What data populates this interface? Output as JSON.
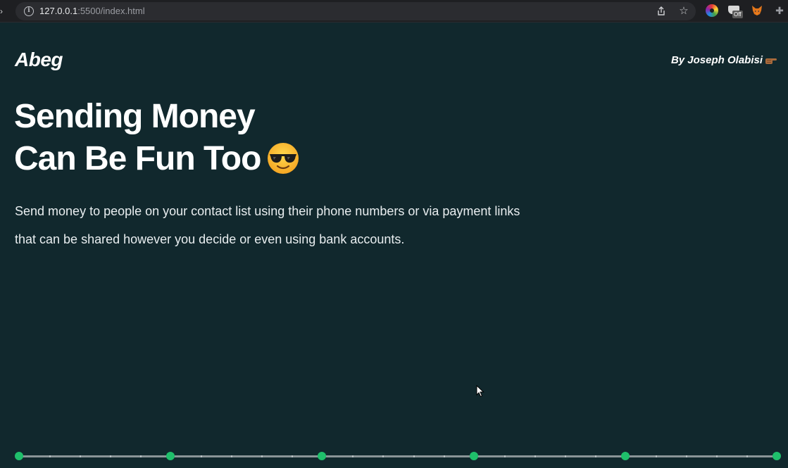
{
  "browser": {
    "url_host": "127.0.0.1",
    "url_rest": ":5500/index.html",
    "extension_off_badge": "Off"
  },
  "site": {
    "logo": "Abeg",
    "byline": "By Joseph Olabisi"
  },
  "hero": {
    "headline_line1": "Sending Money",
    "headline_line2": "Can Be Fun Too",
    "description": "Send money to people on your contact list using their phone numbers or via payment links that can be shared however you decide or even using bank accounts."
  },
  "timeline": {
    "dot_count": 6,
    "color": "#1fbf6b"
  },
  "colors": {
    "background": "#11282d",
    "accent": "#1fbf6b",
    "text": "#ffffff"
  }
}
